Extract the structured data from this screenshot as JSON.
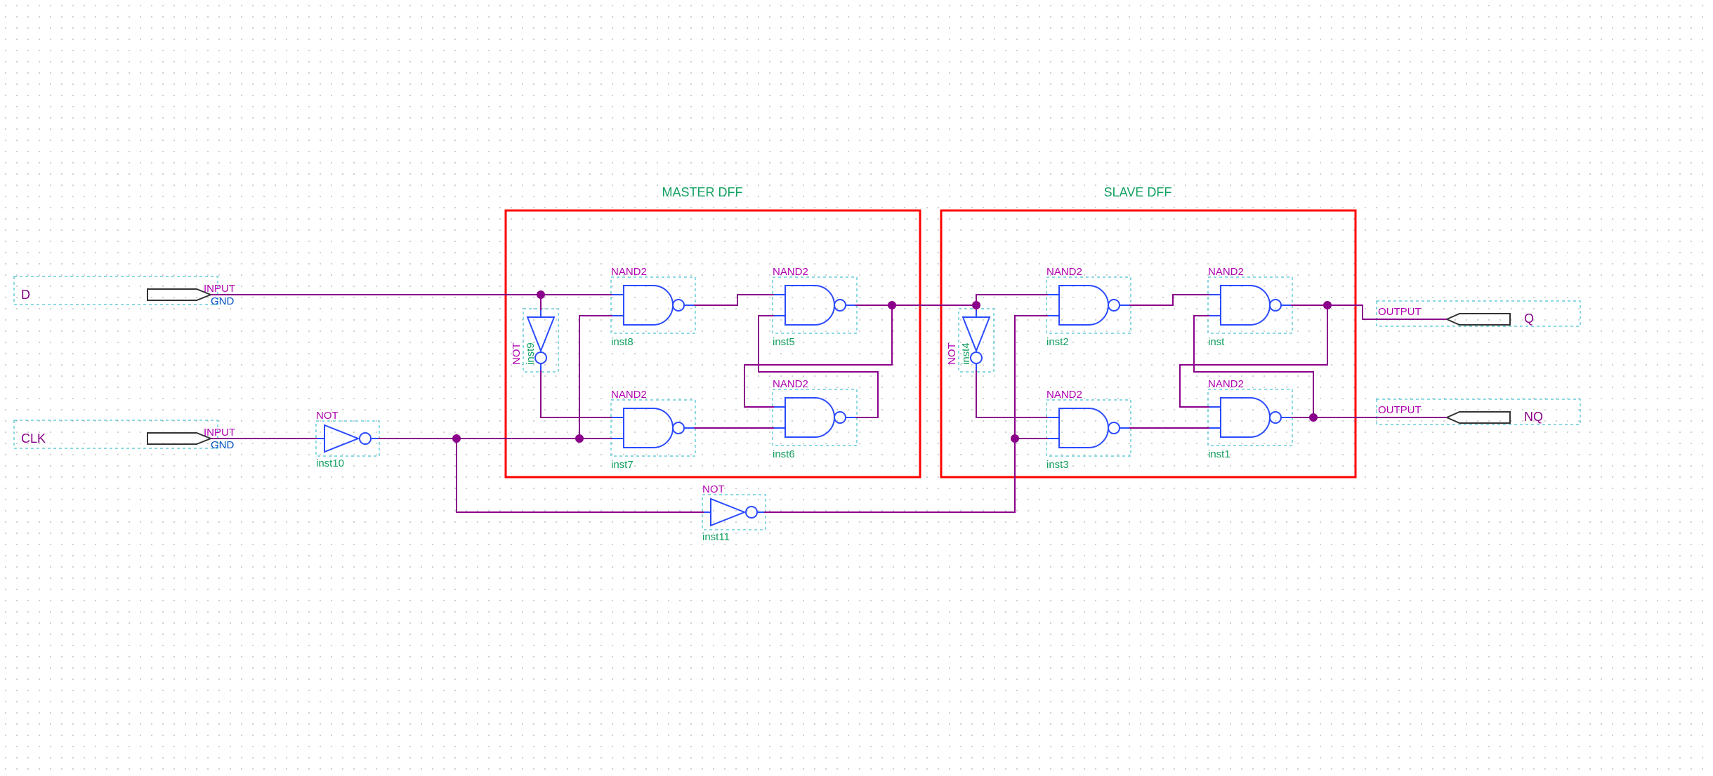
{
  "titles": {
    "master": "MASTER DFF",
    "slave": "SLAVE DFF"
  },
  "pins": {
    "d": {
      "name": "D",
      "type": "INPUT",
      "gnd": "GND"
    },
    "clk": {
      "name": "CLK",
      "type": "INPUT",
      "gnd": "GND"
    },
    "q": {
      "name": "Q",
      "type": "OUTPUT"
    },
    "nq": {
      "name": "NQ",
      "type": "OUTPUT"
    }
  },
  "gates": {
    "inst8": {
      "type": "NAND2",
      "inst": "inst8"
    },
    "inst7": {
      "type": "NAND2",
      "inst": "inst7"
    },
    "inst5": {
      "type": "NAND2",
      "inst": "inst5"
    },
    "inst6": {
      "type": "NAND2",
      "inst": "inst6"
    },
    "inst2": {
      "type": "NAND2",
      "inst": "inst2"
    },
    "inst3": {
      "type": "NAND2",
      "inst": "inst3"
    },
    "inst": {
      "type": "NAND2",
      "inst": "inst"
    },
    "inst1": {
      "type": "NAND2",
      "inst": "inst1"
    },
    "inst9": {
      "type": "NOT",
      "inst": "inst9"
    },
    "inst4": {
      "type": "NOT",
      "inst": "inst4"
    },
    "inst10": {
      "type": "NOT",
      "inst": "inst10"
    },
    "inst11": {
      "type": "NOT",
      "inst": "inst11"
    }
  }
}
